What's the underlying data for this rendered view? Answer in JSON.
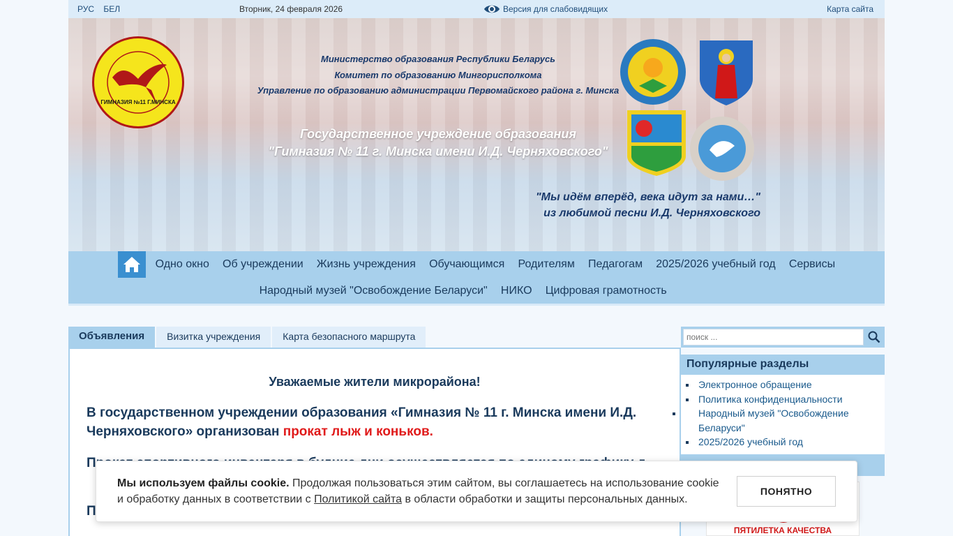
{
  "topbar": {
    "lang_ru": "РУС",
    "lang_be": "БЕЛ",
    "date": "Вторник, 24 февраля 2026",
    "vision": "Версия для слабовидящих",
    "sitemap": "Карта сайта"
  },
  "header": {
    "ministry1": "Министерство образования Республики Беларусь",
    "ministry2": "Комитет по образованию Мингорисполкома",
    "ministry3": "Управление по образованию администрации Первомайского района г. Минска",
    "gym1": "Государственное учреждение образования",
    "gym2": "\"Гимназия № 11 г. Минска имени И.Д. Черняховского\"",
    "quote1": "\"Мы идём вперёд, века идут за нами…\"",
    "quote2": "из любимой песни И.Д. Черняховского",
    "logo_text": "ГИМНАЗИЯ №11 Г.МИНСКА"
  },
  "nav": {
    "row1": [
      "Одно окно",
      "Об учреждении",
      "Жизнь учреждения",
      "Обучающимся",
      "Родителям",
      "Педагогам",
      "2025/2026 учебный год",
      "Сервисы"
    ],
    "row2": [
      "Народный музей \"Освобождение Беларуси\"",
      "НИКО",
      "Цифровая грамотность"
    ]
  },
  "tabs": [
    "Объявления",
    "Визитка учреждения",
    "Карта безопасного маршрута"
  ],
  "content": {
    "heading": "Уважаемые жители микрорайона!",
    "p1_start": "В государственном учреждении образования «Гимназия № 11 г. Минска имени И.Д. Черняховского» организован ",
    "p1_red": "прокат лыж и коньков.",
    "p2": "Прокат спортивного инвентаря в будние дни осуществляется по единому графику д",
    "p3": "П"
  },
  "search": {
    "placeholder": "поиск ..."
  },
  "popular": {
    "title": "Популярные разделы",
    "items": [
      "Электронное обращение",
      "Политика конфиденциальности",
      "Народный музей \"Освобождение Беларуси\"",
      "2025/2026 учебный год"
    ]
  },
  "banner": {
    "text": "ПЯТИЛЕТКА КАЧЕСТВА"
  },
  "cookie": {
    "bold": "Мы используем файлы cookie.",
    "text1": " Продолжая пользоваться этим сайтом, вы соглашаетесь на использование cookie и обработку данных в соответствии с ",
    "link": "Политикой сайта",
    "text2": " в области обработки и защиты персональных данных.",
    "button": "ПОНЯТНО"
  },
  "colors": {
    "nav": "#a8d0ec",
    "home": "#3a8fd0",
    "accent_red": "#e01b1b"
  }
}
